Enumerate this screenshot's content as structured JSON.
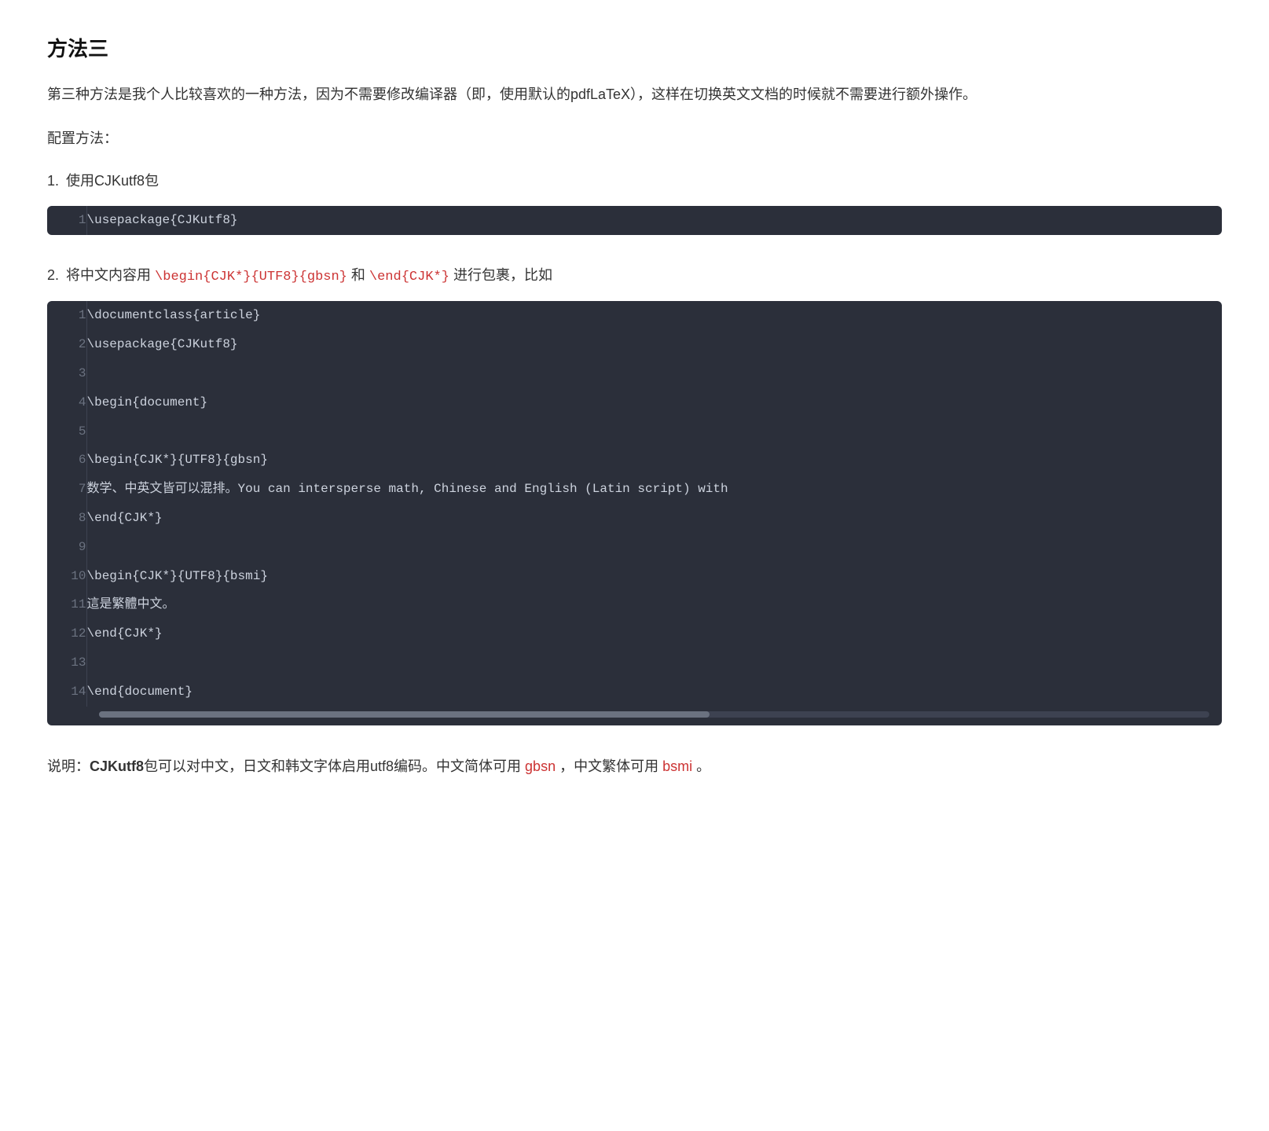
{
  "section": {
    "title": "方法三",
    "intro": "第三种方法是我个人比较喜欢的一种方法，因为不需要修改编译器（即，使用默认的pdfLaTeX），这样在切换英文文档的时候就不需要进行额外操作。",
    "config_label": "配置方法：",
    "steps": [
      {
        "number": "1.",
        "text": "使用CJKutf8包",
        "code_lines": [
          {
            "num": "1",
            "code": "\\usepackage{CJKutf8}"
          }
        ],
        "has_scrollbar": false
      },
      {
        "number": "2.",
        "text_before": "将中文内容用 ",
        "inline1": "\\begin{CJK*}{UTF8}{gbsn}",
        "text_mid": " 和 ",
        "inline2": "\\end{CJK*}",
        "text_after": " 进行包裹，比如",
        "code_lines": [
          {
            "num": "1",
            "code": "\\documentclass{article}"
          },
          {
            "num": "2",
            "code": "\\usepackage{CJKutf8}"
          },
          {
            "num": "3",
            "code": ""
          },
          {
            "num": "4",
            "code": "\\begin{document}"
          },
          {
            "num": "5",
            "code": ""
          },
          {
            "num": "6",
            "code": "\\begin{CJK*}{UTF8}{gbsn}"
          },
          {
            "num": "7",
            "code": "数学、中英文皆可以混排。You can intersperse math, Chinese and English (Latin script) with"
          },
          {
            "num": "8",
            "code": "\\end{CJK*}"
          },
          {
            "num": "9",
            "code": ""
          },
          {
            "num": "10",
            "code": "\\begin{CJK*}{UTF8}{bsmi}"
          },
          {
            "num": "11",
            "code": "這是繁體中文。"
          },
          {
            "num": "12",
            "code": "\\end{CJK*}"
          },
          {
            "num": "13",
            "code": ""
          },
          {
            "num": "14",
            "code": "\\end{document}"
          }
        ],
        "has_scrollbar": true
      }
    ],
    "explanation_before": "说明：",
    "explanation_bold": "CJKutf8",
    "explanation_mid": "包可以对中文，日文和韩文字体启用utf8编码。中文简体可用 ",
    "explanation_gbsn": "gbsn",
    "explanation_mid2": " ，中文繁体可用 ",
    "explanation_bsmi": "bsmi",
    "explanation_end": " 。"
  }
}
